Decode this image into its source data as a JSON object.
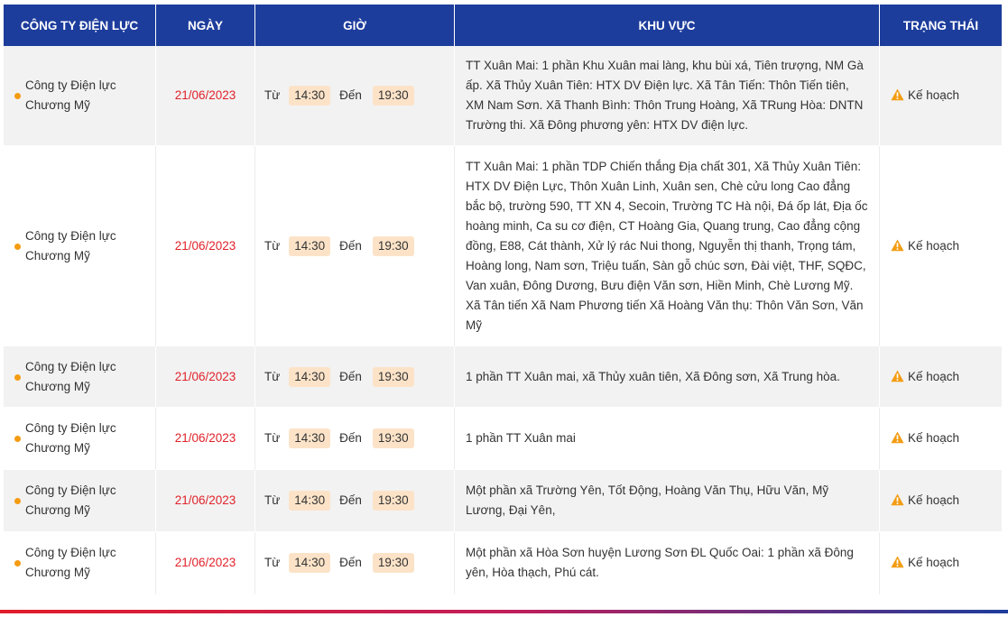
{
  "headers": {
    "company": "CÔNG TY ĐIỆN LỰC",
    "date": "NGÀY",
    "time": "GIỜ",
    "area": "KHU VỰC",
    "status": "TRẠNG THÁI"
  },
  "rows": [
    {
      "company": "Công ty Điện lực Chương Mỹ",
      "date": "21/06/2023",
      "from_label": "Từ",
      "from": "14:30",
      "to_label": "Đến",
      "to": "19:30",
      "area": "TT Xuân Mai: 1 phần Khu Xuân mai làng, khu bùi xá, Tiên trượng, NM Gà ấp. Xã Thủy Xuân Tiên: HTX DV Điện lực. Xã Tân Tiến: Thôn Tiến tiên, XM Nam Sơn. Xã Thanh Bình: Thôn Trung Hoàng, Xã TRung Hòa: DNTN Trường thi. Xã Đông phương yên: HTX DV điện lực.",
      "status": "Kế hoạch"
    },
    {
      "company": "Công ty Điện lực Chương Mỹ",
      "date": "21/06/2023",
      "from_label": "Từ",
      "from": "14:30",
      "to_label": "Đến",
      "to": "19:30",
      "area": "TT Xuân Mai: 1 phần TDP Chiến thắng Địa chất 301, Xã Thủy Xuân Tiên: HTX DV Điện Lực, Thôn Xuân Linh, Xuân sen, Chè cửu long Cao đẳng bắc bộ, trường 590, TT XN 4, Secoin, Trường TC Hà nội, Đá ốp lát, Địa ốc hoàng minh, Ca su cơ điện, CT Hoàng Gia, Quang trung, Cao đẳng cộng đồng, E88, Cát thành, Xử lý rác Nui thong, Nguyễn thị thanh, Trọng tám, Hoàng long, Nam sơn, Triệu tuấn, Sàn gỗ chúc sơn, Đài việt, THF, SQĐC, Van xuân, Đông Dương, Bưu điện Văn sơn, Hiền Minh, Chè Lương Mỹ. Xã Tân tiến Xã Nam Phương tiến Xã Hoàng Văn thụ: Thôn Văn Sơn, Văn Mỹ",
      "status": "Kế hoạch"
    },
    {
      "company": "Công ty Điện lực Chương Mỹ",
      "date": "21/06/2023",
      "from_label": "Từ",
      "from": "14:30",
      "to_label": "Đến",
      "to": "19:30",
      "area": "1 phần TT Xuân mai, xã Thủy xuân tiên, Xã Đông sơn, Xã Trung hòa.",
      "status": "Kế hoạch"
    },
    {
      "company": "Công ty Điện lực Chương Mỹ",
      "date": "21/06/2023",
      "from_label": "Từ",
      "from": "14:30",
      "to_label": "Đến",
      "to": "19:30",
      "area": "1 phần TT Xuân mai",
      "status": "Kế hoạch"
    },
    {
      "company": "Công ty Điện lực Chương Mỹ",
      "date": "21/06/2023",
      "from_label": "Từ",
      "from": "14:30",
      "to_label": "Đến",
      "to": "19:30",
      "area": "Một phần xã Trường Yên, Tốt Động, Hoàng Văn Thụ, Hữu Văn, Mỹ Lương, Đại Yên,",
      "status": "Kế hoạch"
    },
    {
      "company": "Công ty Điện lực Chương Mỹ",
      "date": "21/06/2023",
      "from_label": "Từ",
      "from": "14:30",
      "to_label": "Đến",
      "to": "19:30",
      "area": "Một phần xã Hòa Sơn huyện Lương Sơn ĐL Quốc Oai: 1 phần xã Đông yên, Hòa thạch, Phú cát.",
      "status": "Kế hoạch"
    }
  ],
  "colors": {
    "header_bg": "#1d3d9c",
    "date_text": "#e0222a",
    "time_pill": "#fce3c8",
    "dot": "#f39c12",
    "warning": "#f39c12"
  },
  "icons": {
    "status": "warning-triangle-icon",
    "company_marker": "bullet-dot-icon"
  }
}
